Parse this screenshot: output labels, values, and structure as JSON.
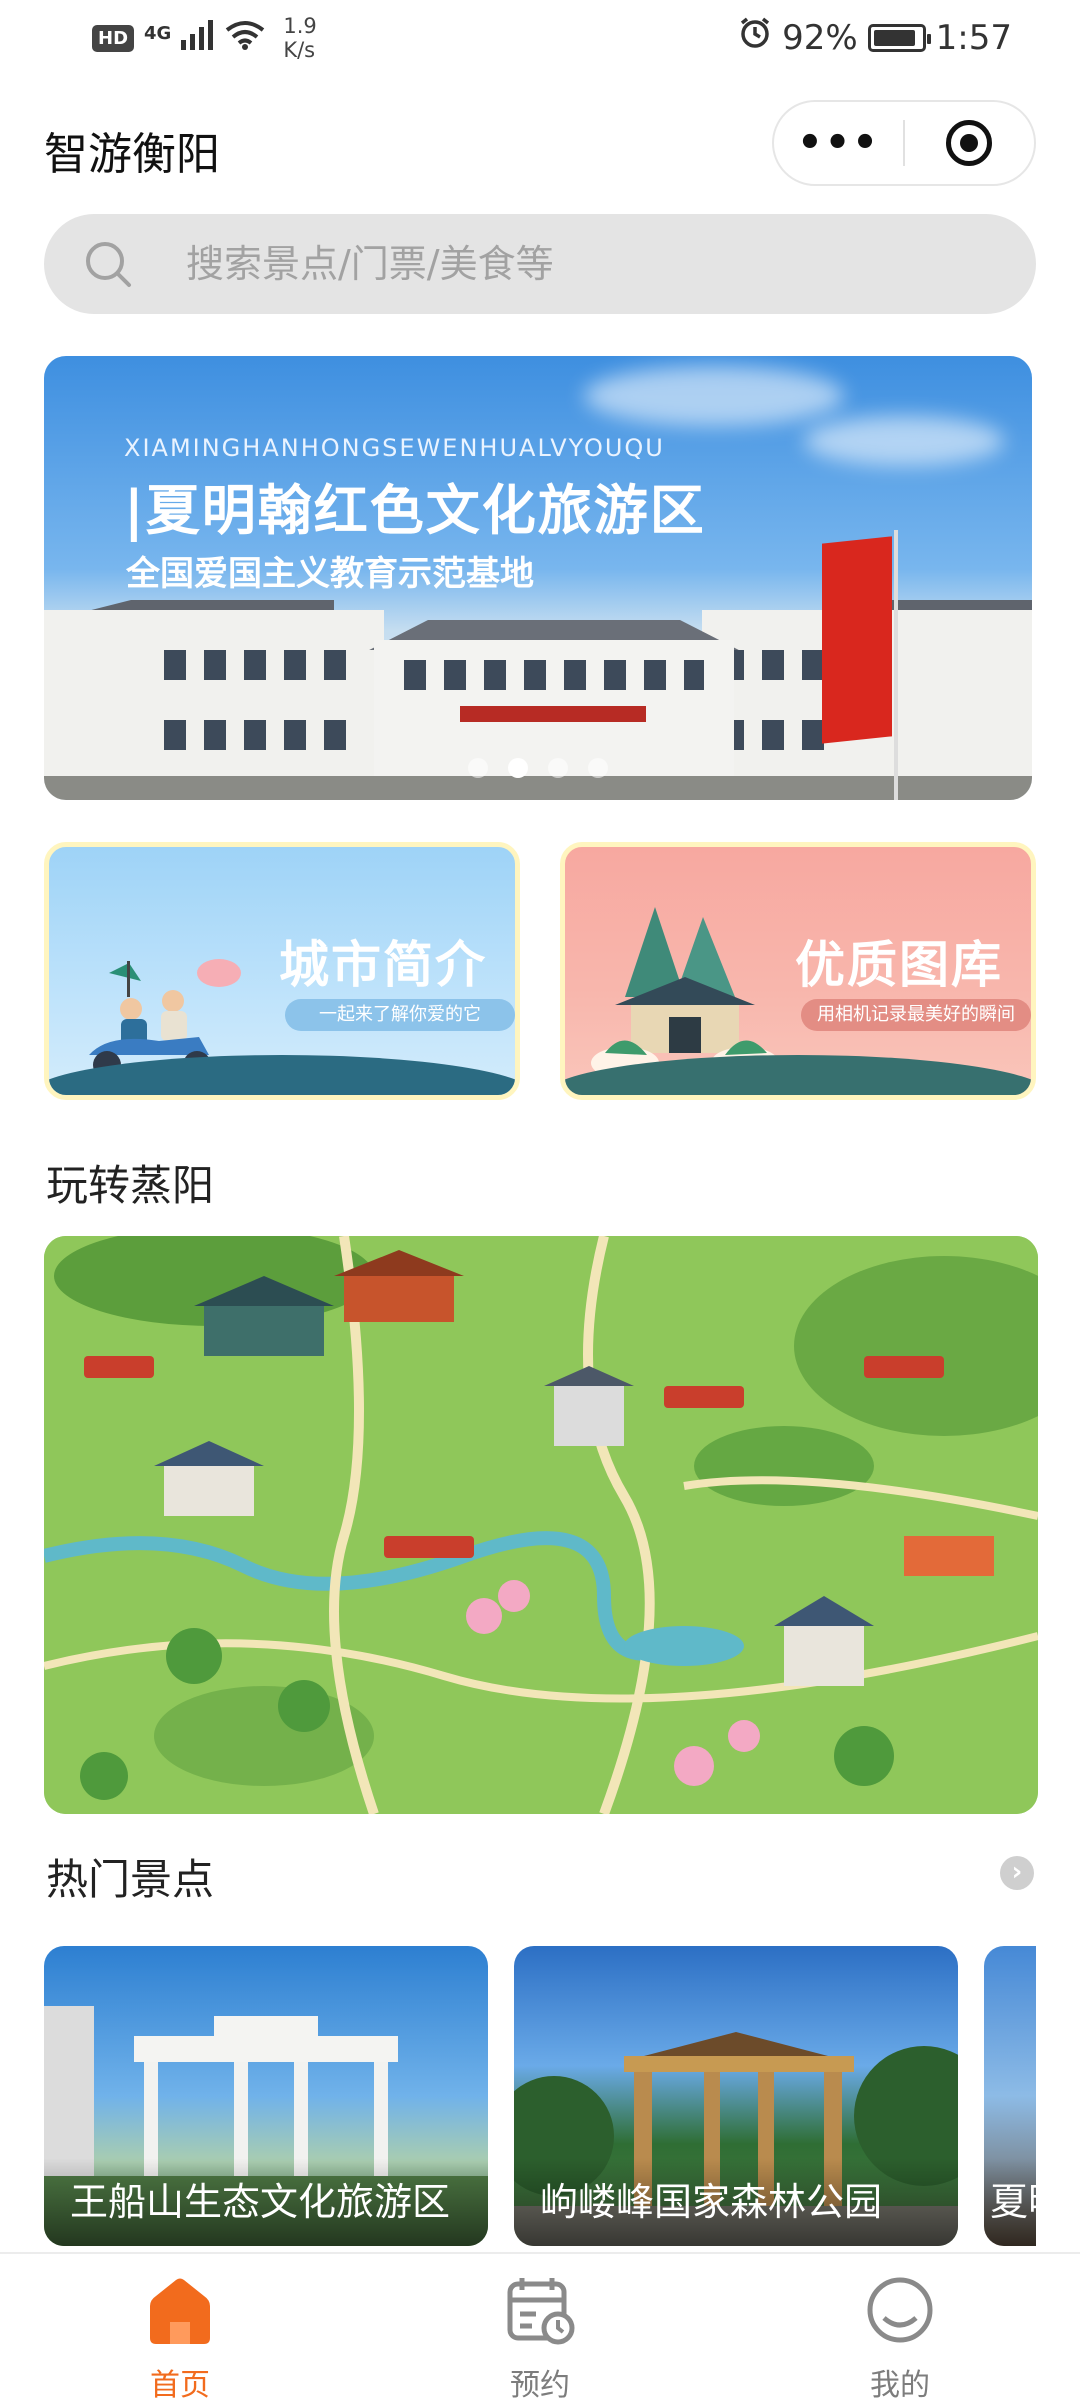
{
  "status_bar": {
    "hd": "HD",
    "network": "4G",
    "speed_value": "1.9",
    "speed_unit": "K/s",
    "battery": "92%",
    "battery_level": 0.92,
    "time": "1:57"
  },
  "header": {
    "title": "智游衡阳",
    "more_label": "•••"
  },
  "search": {
    "placeholder": "搜索景点/门票/美食等"
  },
  "banner": {
    "pinyin": "XIAMINGHANHONGSEWENHUALVYOUQU",
    "title": "|夏明翰红色文化旅游区",
    "subtitle": "全国爱国主义教育示范基地",
    "slide_count": 4,
    "active_slide": 1
  },
  "cards": [
    {
      "title": "城市简介",
      "subtitle": "一起来了解你爱的它"
    },
    {
      "title": "优质图库",
      "subtitle": "用相机记录最美好的瞬间"
    }
  ],
  "sections": {
    "play": "玩转蒸阳",
    "hot": "热门景点",
    "more_icon": "chevron-right-icon"
  },
  "scenic_spots": [
    {
      "name": "王船山生态文化旅游区"
    },
    {
      "name": "岣嵝峰国家森林公园"
    },
    {
      "name": "夏明"
    }
  ],
  "tabs": [
    {
      "label": "首页",
      "icon": "home-icon",
      "active": true
    },
    {
      "label": "预约",
      "icon": "calendar-icon",
      "active": false
    },
    {
      "label": "我的",
      "icon": "profile-icon",
      "active": false
    }
  ],
  "colors": {
    "accent": "#f26b1d",
    "tab_inactive": "#7d7d7d",
    "search_bg": "#e4e4e4"
  }
}
